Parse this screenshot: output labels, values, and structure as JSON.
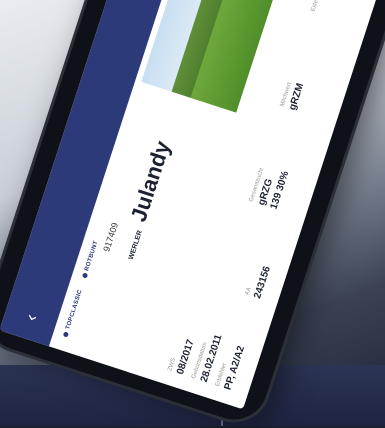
{
  "app": {
    "toolbar": {
      "back_icon": "chevron-left-icon",
      "star_icon": "star-icon",
      "share_icon": "share-icon"
    },
    "accent": "#2c3a7a"
  },
  "animal": {
    "breadcrumb": [
      "TOPCLASSIC",
      "ROTBUNT"
    ],
    "number": "917409",
    "farm": "WERLER",
    "name": "Julandy",
    "fields": [
      {
        "label": "ZWS",
        "value": "08/2017"
      },
      {
        "label": "Geburtsdatum",
        "value": "28.02.2011"
      },
      {
        "label": "Erbfehler",
        "value": "PP, A2/A2"
      },
      {
        "label": "AA",
        "value": "243156"
      },
      {
        "label": "Gesamtzucht",
        "value": "gRZG"
      },
      {
        "label": "Milchwert",
        "value": "gRZM"
      },
      {
        "label": "Exterieur",
        "value": ""
      }
    ],
    "bottom_values": [
      "139",
      "30%"
    ]
  }
}
